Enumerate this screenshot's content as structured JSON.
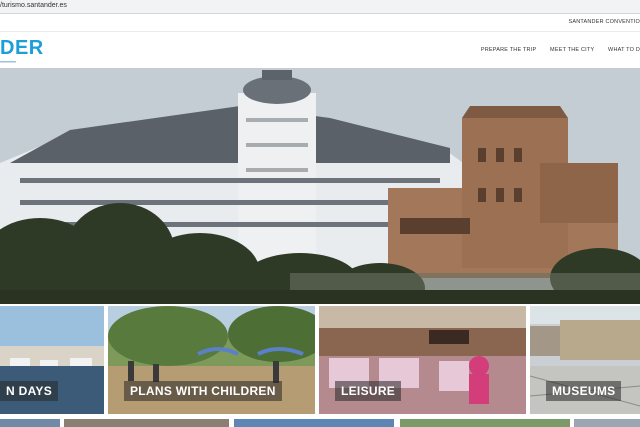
{
  "browser": {
    "url": "/turismo.santander.es"
  },
  "topbar": {
    "conventions_label": "SANTANDER CONVENTIO"
  },
  "header": {
    "logo_text": "DER",
    "nav": [
      {
        "label": "PREPARE THE TRIP"
      },
      {
        "label": "MEET THE CITY"
      },
      {
        "label": "WHAT TO D"
      }
    ]
  },
  "tiles": [
    {
      "label": "N DAYS"
    },
    {
      "label": "PLANS WITH CHILDREN"
    },
    {
      "label": "LEISURE"
    },
    {
      "label": "MUSEUMS"
    }
  ],
  "colors": {
    "brand": "#1c9ed8",
    "tile_label_bg": "#383838"
  }
}
